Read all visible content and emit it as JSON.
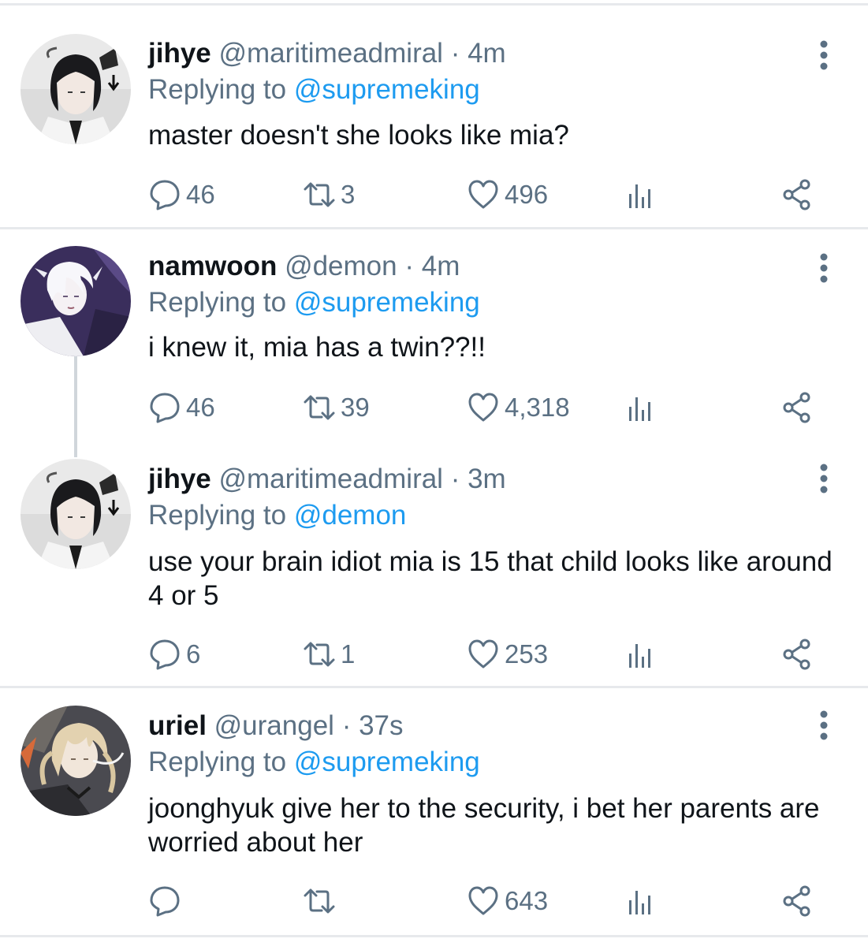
{
  "colors": {
    "text": "#0f1419",
    "muted": "#5b7083",
    "link": "#1d9bf0",
    "divider": "#e7e9ec"
  },
  "tweets": [
    {
      "display_name": "jihye",
      "handle": "@maritimeadmiral",
      "separator": "·",
      "time": "4m",
      "replying_prefix": "Replying to",
      "replying_to": "@supremeking",
      "text": "master doesn't she looks like mia?",
      "replies": "46",
      "retweets": "3",
      "likes": "496",
      "avatar_icon": "avatar-dark-hair"
    },
    {
      "display_name": "namwoon",
      "handle": "@demon",
      "separator": "·",
      "time": "4m",
      "replying_prefix": "Replying to",
      "replying_to": "@supremeking",
      "text": "i knew it, mia has a twin??!!",
      "replies": "46",
      "retweets": "39",
      "likes": "4,318",
      "avatar_icon": "avatar-white-hair"
    },
    {
      "display_name": "jihye",
      "handle": "@maritimeadmiral",
      "separator": "·",
      "time": "3m",
      "replying_prefix": "Replying to",
      "replying_to": "@demon",
      "text": "use your brain idiot mia is 15 that child looks like around 4 or 5",
      "replies": "6",
      "retweets": "1",
      "likes": "253",
      "avatar_icon": "avatar-dark-hair"
    },
    {
      "display_name": "uriel",
      "handle": "@urangel",
      "separator": "·",
      "time": "37s",
      "replying_prefix": "Replying to",
      "replying_to": "@supremeking",
      "text": "joonghyuk give her to the security, i bet her parents are worried about her",
      "replies": "",
      "retweets": "",
      "likes": "643",
      "avatar_icon": "avatar-blonde-hair"
    }
  ]
}
